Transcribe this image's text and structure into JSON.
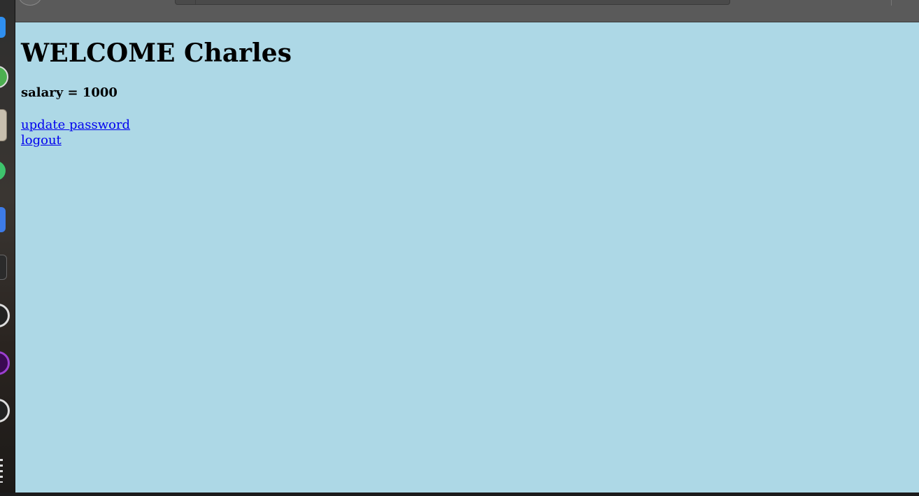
{
  "page": {
    "heading": "WELCOME Charles",
    "salary_text": "salary = 1000",
    "links": [
      {
        "label": "update password"
      },
      {
        "label": "logout"
      }
    ],
    "background_color": "#add8e6",
    "link_color": "#0000ee"
  },
  "dock": {
    "icons": [
      "app-icon-blue",
      "app-icon-green",
      "app-icon-files",
      "app-icon-green-2",
      "app-icon-blue-2",
      "app-icon-terminal",
      "app-icon-circle",
      "app-icon-purple",
      "app-icon-circle-2",
      "app-grid-icon"
    ]
  }
}
